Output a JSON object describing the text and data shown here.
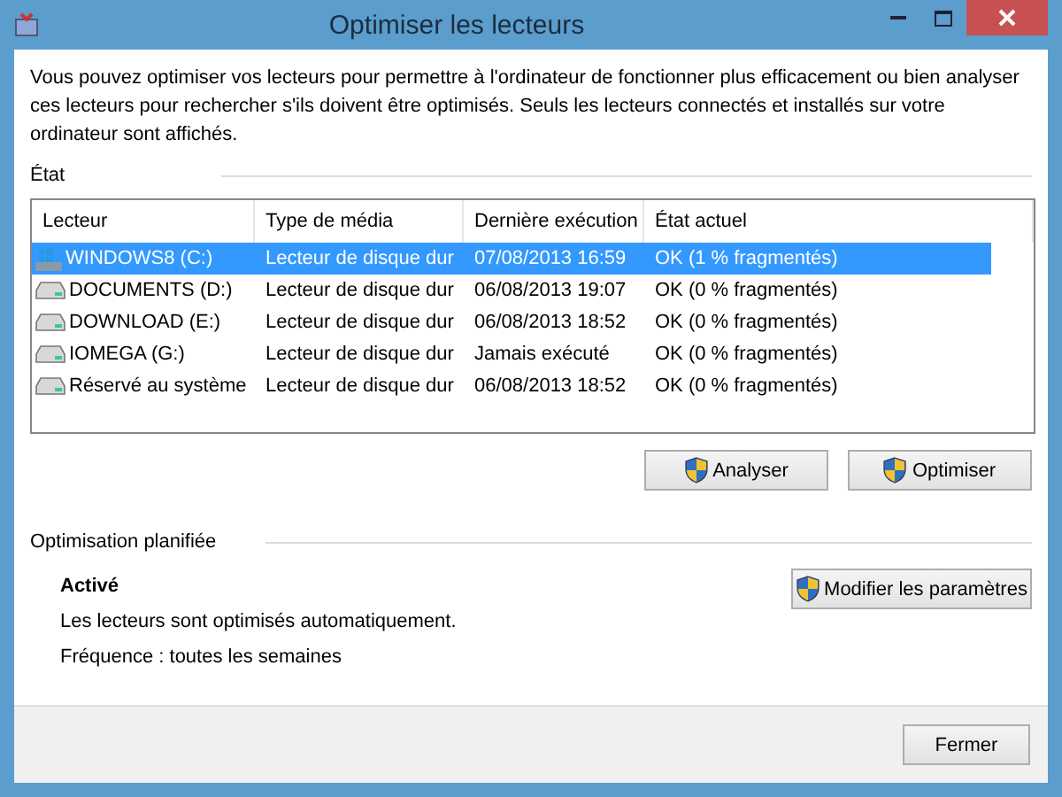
{
  "window": {
    "title": "Optimiser les lecteurs"
  },
  "description": "Vous pouvez optimiser vos lecteurs pour permettre à l'ordinateur de fonctionner plus efficacement ou bien analyser ces lecteurs pour rechercher s'ils doivent être optimisés. Seuls les lecteurs connectés et installés sur votre ordinateur sont affichés.",
  "status_section": {
    "title": "État"
  },
  "table": {
    "columns": [
      "Lecteur",
      "Type de média",
      "Dernière exécution",
      "État actuel"
    ],
    "rows": [
      {
        "kind": "system",
        "selected": true,
        "cells": [
          "WINDOWS8 (C:)",
          "Lecteur de disque dur",
          "07/08/2013 16:59",
          "OK (1 % fragmentés)"
        ]
      },
      {
        "kind": "disk",
        "selected": false,
        "cells": [
          "DOCUMENTS (D:)",
          "Lecteur de disque dur",
          "06/08/2013 19:07",
          "OK (0 % fragmentés)"
        ]
      },
      {
        "kind": "disk",
        "selected": false,
        "cells": [
          "DOWNLOAD (E:)",
          "Lecteur de disque dur",
          "06/08/2013 18:52",
          "OK (0 % fragmentés)"
        ]
      },
      {
        "kind": "disk",
        "selected": false,
        "cells": [
          "IOMEGA (G:)",
          "Lecteur de disque dur",
          "Jamais exécuté",
          "OK (0 % fragmentés)"
        ]
      },
      {
        "kind": "disk",
        "selected": false,
        "cells": [
          "Réservé au système",
          "Lecteur de disque dur",
          "06/08/2013 18:52",
          "OK (0 % fragmentés)"
        ]
      }
    ]
  },
  "actions": [
    "Analyser",
    "Optimiser"
  ],
  "schedule": {
    "title": "Optimisation planifiée",
    "state": "Activé",
    "line_1": "Les lecteurs sont optimisés automatiquement.",
    "line_2": "Fréquence : toutes les semaines",
    "button": "Modifier les paramètres"
  },
  "footer": {
    "button": "Fermer"
  }
}
